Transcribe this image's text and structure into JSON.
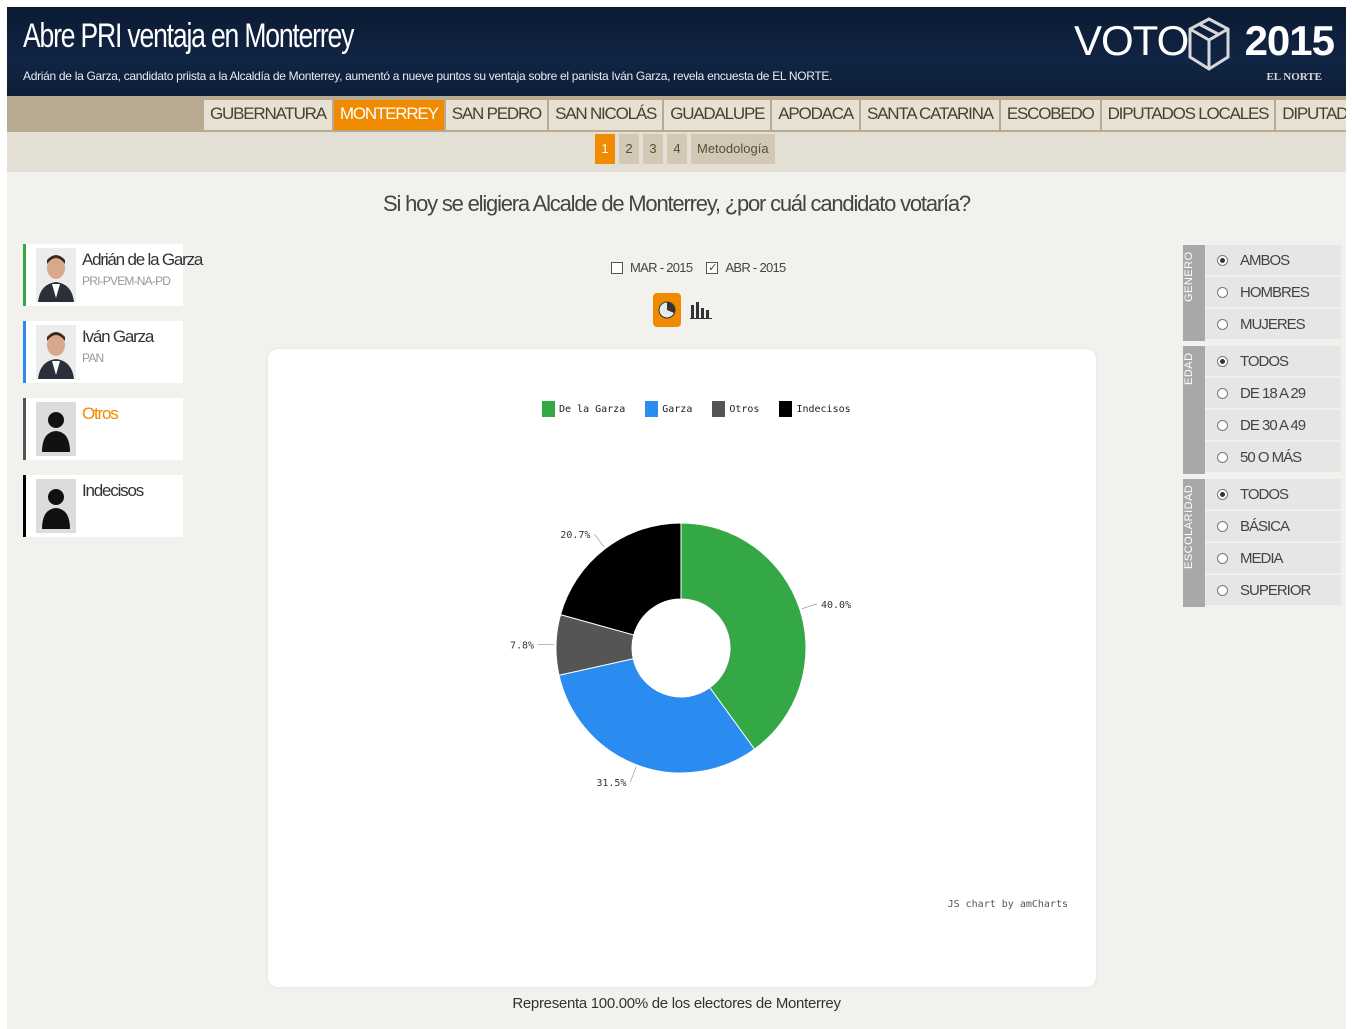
{
  "header": {
    "title": "Abre PRI ventaja en Monterrey",
    "subtitle": "Adrián de la Garza, candidato priista a la Alcaldía de Monterrey, aumentó a nueve puntos su ventaja sobre el panista Iván Garza, revela encuesta de EL NORTE.",
    "brand_voto": "VOTO",
    "brand_year": "2015",
    "brand_paper": "EL NORTE"
  },
  "nav": {
    "tabs": [
      "GUBERNATURA",
      "MONTERREY",
      "SAN PEDRO",
      "SAN NICOLÁS",
      "GUADALUPE",
      "APODACA",
      "SANTA CATARINA",
      "ESCOBEDO",
      "DIPUTADOS LOCALES",
      "DIPUTADOS FEDERALES"
    ],
    "active": "MONTERREY"
  },
  "subnav": {
    "pages": [
      "1",
      "2",
      "3",
      "4",
      "Metodología"
    ],
    "active": "1"
  },
  "question": "Si hoy se eligiera Alcalde de Monterrey, ¿por cuál candidato votaría?",
  "candidates": [
    {
      "name": "Adrián de la Garza",
      "party": "PRI-PVEM-NA-PD",
      "color": "#33a845"
    },
    {
      "name": "Iván Garza",
      "party": "PAN",
      "color": "#2a8cf0"
    },
    {
      "name": "Otros",
      "party": "",
      "color": "#555555"
    },
    {
      "name": "Indecisos",
      "party": "",
      "color": "#000000"
    }
  ],
  "periods": [
    {
      "label": "MAR - 2015",
      "checked": false
    },
    {
      "label": "ABR - 2015",
      "checked": true
    }
  ],
  "view_buttons": {
    "pie": "pie-chart-icon",
    "bar": "bar-chart-icon",
    "active": "pie"
  },
  "chart_data": {
    "type": "pie",
    "donut": true,
    "categories": [
      "De la Garza",
      "Garza",
      "Otros",
      "Indecisos"
    ],
    "values": [
      40.0,
      31.5,
      7.8,
      20.7
    ],
    "value_labels": [
      "40.0%",
      "31.5%",
      "7.8%",
      "20.7%"
    ],
    "colors": [
      "#33a845",
      "#2a8cf0",
      "#555555",
      "#000000"
    ],
    "legend_position": "top",
    "credit": "JS chart by amCharts"
  },
  "footer": "Representa 100.00% de los electores de Monterrey",
  "filters": [
    {
      "group": "GENERO",
      "options": [
        "AMBOS",
        "HOMBRES",
        "MUJERES"
      ],
      "selected": 0
    },
    {
      "group": "EDAD",
      "options": [
        "TODOS",
        "DE 18 A 29",
        "DE 30 A 49",
        "50 O MÁS"
      ],
      "selected": 0
    },
    {
      "group": "ESCOLARIDAD",
      "options": [
        "TODOS",
        "BÁSICA",
        "MEDIA",
        "SUPERIOR"
      ],
      "selected": 0
    }
  ]
}
